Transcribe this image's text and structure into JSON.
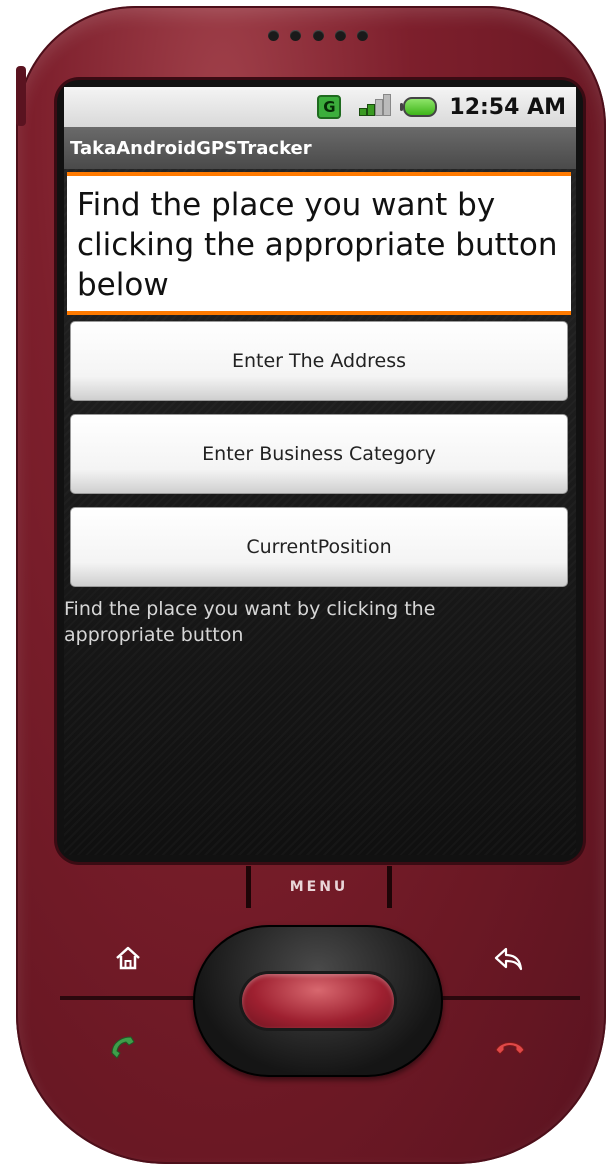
{
  "statusbar": {
    "network_type": "G",
    "time": "12:54 AM"
  },
  "app": {
    "title": "TakaAndroidGPSTracker"
  },
  "main": {
    "heading": "Find the place you want by clicking the appropriate button below",
    "buttons": [
      {
        "label": "Enter The Address"
      },
      {
        "label": "Enter Business Category"
      },
      {
        "label": "CurrentPosition"
      }
    ],
    "hint": "Find the place you want by clicking the appropriate button"
  },
  "device": {
    "menu_label": "MENU",
    "icons": [
      "home-icon",
      "back-icon",
      "call-icon",
      "end-call-icon"
    ]
  },
  "colors": {
    "accent": "#ff7a00",
    "phone_body": "#7d1f2c",
    "titlebar": "#4a4a4a"
  }
}
